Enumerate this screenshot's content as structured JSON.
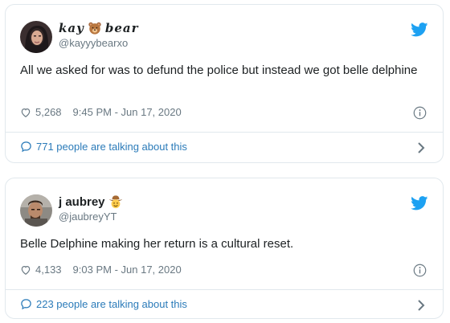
{
  "tweets": [
    {
      "display_name_left": "kay",
      "display_name_right": "bear",
      "handle": "@kayyybearxo",
      "text": "All we asked for was to defund the police but instead we got belle delphine",
      "likes": "5,268",
      "timestamp": "9:45 PM - Jun 17, 2020",
      "talk": "771 people are talking about this"
    },
    {
      "display_name": "j aubrey",
      "handle": "@jaubreyYT",
      "text": "Belle Delphine making her return is a cultural reset.",
      "likes": "4,133",
      "timestamp": "9:03 PM - Jun 17, 2020",
      "talk": "223 people are talking about this"
    }
  ],
  "colors": {
    "brand_blue": "#1da1f2",
    "link_blue": "#2b7bb9",
    "muted_gray": "#697882",
    "border": "#e1e8ed"
  },
  "icons": [
    "twitter-bird-icon",
    "heart-icon",
    "info-icon",
    "speech-bubble-icon",
    "chevron-right-icon",
    "bear-face-emoji",
    "cowboy-face-emoji"
  ]
}
